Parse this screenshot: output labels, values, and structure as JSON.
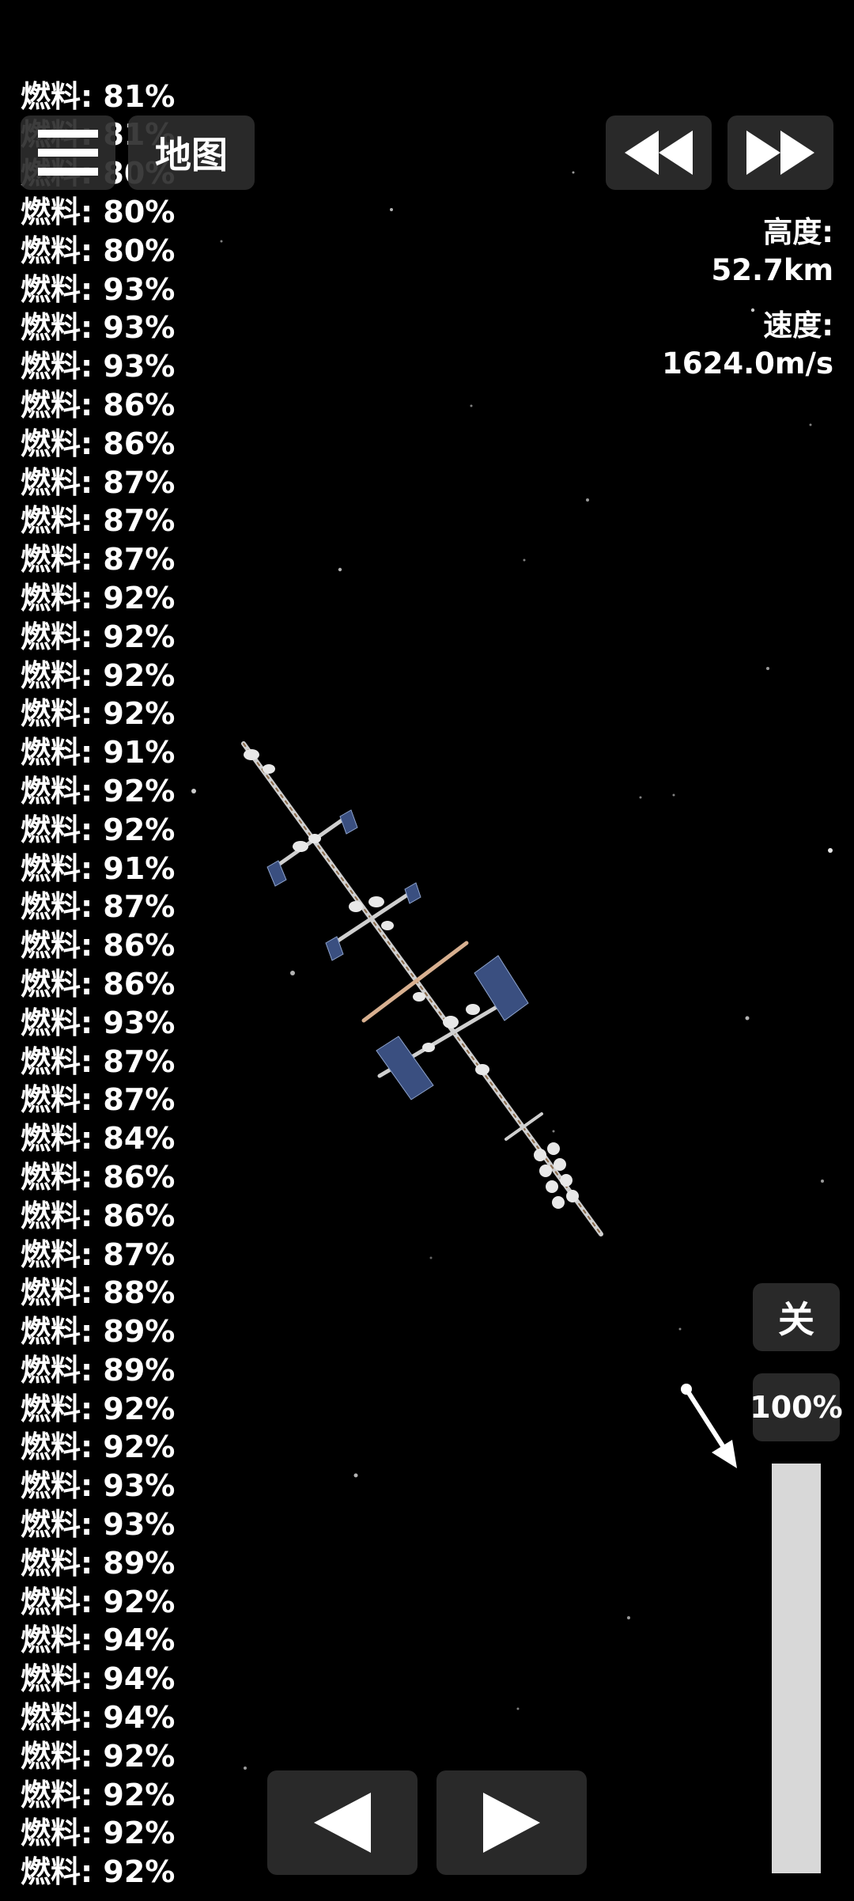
{
  "hud": {
    "map_label": "地图",
    "altitude_label": "高度:",
    "altitude_value": "52.7km",
    "speed_label": "速度:",
    "speed_value": "1624.0m/s",
    "engine_toggle_label": "关",
    "throttle_label": "100%",
    "throttle_level": 1.0
  },
  "icons": {
    "menu": "hamburger-menu-icon",
    "rewind": "rewind-icon",
    "fast_forward": "fast-forward-icon",
    "rotate_left": "triangle-left-icon",
    "rotate_right": "triangle-right-icon",
    "throttle_pointer": "arrow-icon"
  },
  "fuel_partial_top": [
    "燃料: 81%",
    "燃料: 81%",
    "燃料: 80%"
  ],
  "fuel_readings": [
    "燃料: 80%",
    "燃料: 80%",
    "燃料: 93%",
    "燃料: 93%",
    "燃料: 93%",
    "燃料: 86%",
    "燃料: 86%",
    "燃料: 87%",
    "燃料: 87%",
    "燃料: 87%",
    "燃料: 92%",
    "燃料: 92%",
    "燃料: 92%",
    "燃料: 92%",
    "燃料: 91%",
    "燃料: 92%",
    "燃料: 92%",
    "燃料: 91%",
    "燃料: 87%",
    "燃料: 86%",
    "燃料: 86%",
    "燃料: 93%",
    "燃料: 87%",
    "燃料: 87%",
    "燃料: 84%",
    "燃料: 86%",
    "燃料: 86%",
    "燃料: 87%",
    "燃料: 88%",
    "燃料: 89%",
    "燃料: 89%",
    "燃料: 92%",
    "燃料: 92%",
    "燃料: 93%",
    "燃料: 93%",
    "燃料: 89%",
    "燃料: 92%",
    "燃料: 94%",
    "燃料: 94%",
    "燃料: 94%",
    "燃料: 92%",
    "燃料: 92%",
    "燃料: 92%",
    "燃料: 92%"
  ],
  "colors": {
    "background": "#000000",
    "button_bg": "#2d2d2d",
    "throttle_bar": "#d8d8d8",
    "solar_panel": "#3a4f80"
  }
}
